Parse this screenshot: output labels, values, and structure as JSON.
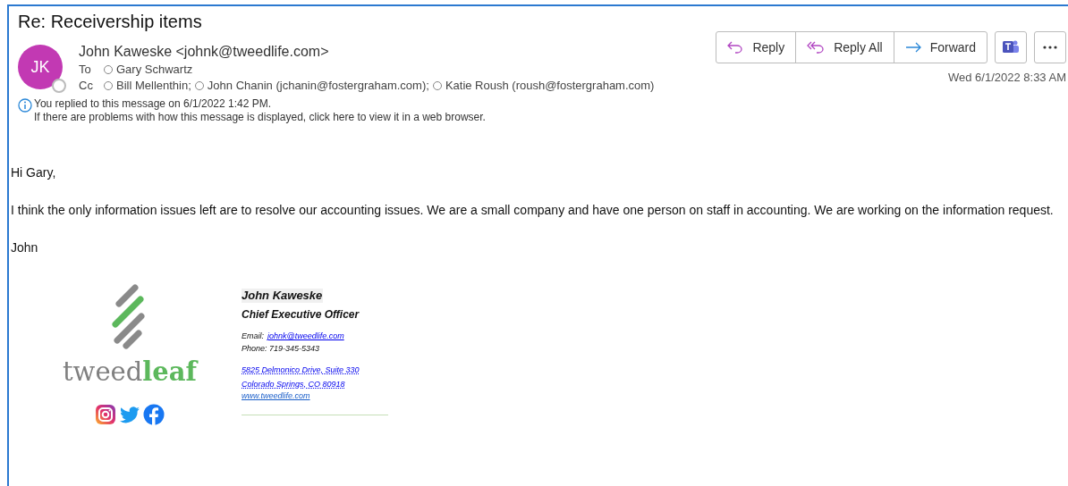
{
  "message": {
    "subject": "Re: Receivership items",
    "avatar_initials": "JK",
    "sender": "John Kaweske <johnk@tweedlife.com>",
    "to_label": "To",
    "to": [
      "Gary Schwartz"
    ],
    "cc_label": "Cc",
    "cc": [
      "Bill Mellenthin;",
      "John Chanin (jchanin@fostergraham.com);",
      "Katie Roush (roush@fostergraham.com)"
    ],
    "info_lines": [
      "You replied to this message on 6/1/2022 1:42 PM.",
      "If there are problems with how this message is displayed, click here to view it in a web browser."
    ],
    "actions": [
      {
        "label": "Reply",
        "kind": "reply"
      },
      {
        "label": "Reply All",
        "kind": "reply_all"
      },
      {
        "label": "Forward",
        "kind": "forward"
      }
    ],
    "date": "Wed 6/1/2022 8:33 AM"
  },
  "body": [
    "Hi Gary,",
    "I think the only information issues left are to resolve our accounting issues. We are a small company and have one person on staff in accounting. We are working on the information request.",
    "John"
  ],
  "signature": {
    "logo_parts": [
      {
        "text": "tweed",
        "color": "#808080",
        "bold": false
      },
      {
        "text": "leaf",
        "color": "#5cb85c",
        "bold": true
      }
    ],
    "name": "John Kaweske",
    "title": "Chief Executive Officer",
    "email_label": "Email:",
    "email": "johnk@tweedlife.com",
    "phone": "Phone: 719-345-5343",
    "address": [
      "5825 Delmonico Drive, Suite 330",
      "Colorado Springs, CO 80918"
    ],
    "website": "www.tweedlife.com"
  }
}
